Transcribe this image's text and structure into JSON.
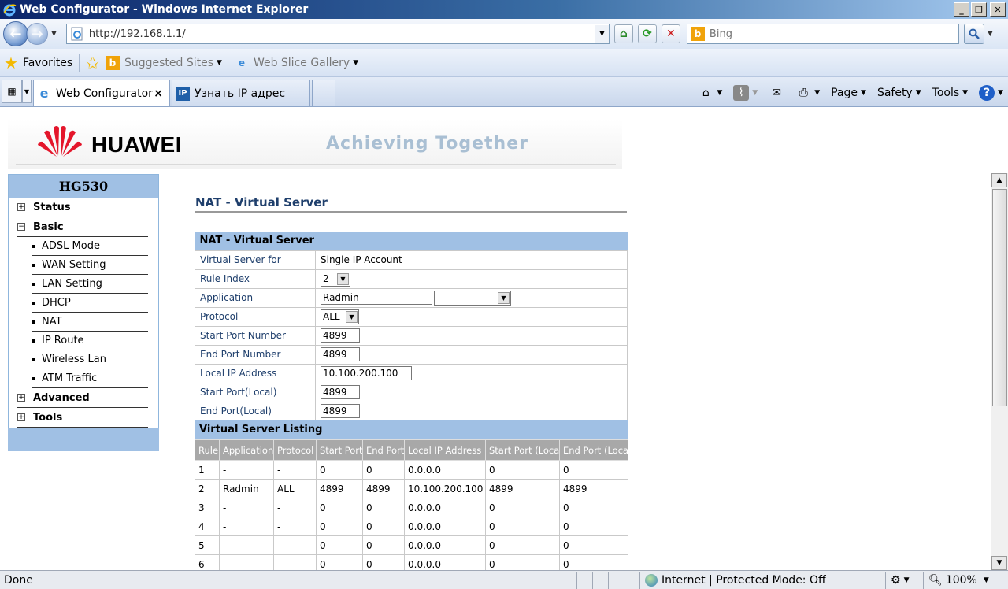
{
  "window": {
    "title": "Web Configurator - Windows Internet Explorer"
  },
  "address_bar": {
    "url": "http://192.168.1.1/",
    "search_placeholder": "Bing"
  },
  "favorites_bar": {
    "favorites_label": "Favorites",
    "items": [
      {
        "label": "Suggested Sites",
        "icon": "bing-icon"
      },
      {
        "label": "Web Slice Gallery",
        "icon": "ie-page-icon"
      }
    ]
  },
  "tabs": [
    {
      "label": "Web Configurator",
      "icon": "ie-page-icon",
      "active": true,
      "close": "×"
    },
    {
      "label": "Узнать IP адрес",
      "icon": "ip-icon",
      "icon_text": "IP",
      "active": false
    }
  ],
  "command_bar": {
    "page": "Page",
    "safety": "Safety",
    "tools": "Tools"
  },
  "banner": {
    "brand": "HUAWEI",
    "slogan": "Achieving Together"
  },
  "sidebar": {
    "model": "HG530",
    "items": [
      {
        "label": "Status",
        "expander": "+"
      },
      {
        "label": "Basic",
        "expander": "−"
      },
      {
        "label": "ADSL Mode"
      },
      {
        "label": "WAN Setting"
      },
      {
        "label": "LAN Setting"
      },
      {
        "label": "DHCP"
      },
      {
        "label": "NAT"
      },
      {
        "label": "IP Route"
      },
      {
        "label": "Wireless Lan"
      },
      {
        "label": "ATM Traffic"
      },
      {
        "label": "Advanced",
        "expander": "+"
      },
      {
        "label": "Tools",
        "expander": "+"
      }
    ]
  },
  "main": {
    "page_title": "NAT - Virtual Server",
    "form": {
      "section_title": "NAT - Virtual Server",
      "virtual_server_for": {
        "label": "Virtual Server for",
        "value": "Single IP Account"
      },
      "rule_index": {
        "label": "Rule Index",
        "value": "2"
      },
      "application": {
        "label": "Application",
        "value": "Radmin",
        "preset": "-"
      },
      "protocol": {
        "label": "Protocol",
        "value": "ALL"
      },
      "start_port": {
        "label": "Start Port Number",
        "value": "4899"
      },
      "end_port": {
        "label": "End Port Number",
        "value": "4899"
      },
      "local_ip": {
        "label": "Local IP Address",
        "value": "10.100.200.100"
      },
      "start_port_local": {
        "label": "Start Port(Local)",
        "value": "4899"
      },
      "end_port_local": {
        "label": "End Port(Local)",
        "value": "4899"
      }
    },
    "listing": {
      "title": "Virtual Server Listing",
      "headers": [
        "Rule",
        "Application",
        "Protocol",
        "Start Port",
        "End Port",
        "Local IP Address",
        "Start Port (Local)",
        "End Port (Local)"
      ],
      "rows": [
        [
          "1",
          "-",
          "-",
          "0",
          "0",
          "0.0.0.0",
          "0",
          "0"
        ],
        [
          "2",
          "Radmin",
          "ALL",
          "4899",
          "4899",
          "10.100.200.100",
          "4899",
          "4899"
        ],
        [
          "3",
          "-",
          "-",
          "0",
          "0",
          "0.0.0.0",
          "0",
          "0"
        ],
        [
          "4",
          "-",
          "-",
          "0",
          "0",
          "0.0.0.0",
          "0",
          "0"
        ],
        [
          "5",
          "-",
          "-",
          "0",
          "0",
          "0.0.0.0",
          "0",
          "0"
        ],
        [
          "6",
          "-",
          "-",
          "0",
          "0",
          "0.0.0.0",
          "0",
          "0"
        ]
      ]
    }
  },
  "status_bar": {
    "status": "Done",
    "zone": "Internet | Protected Mode: Off",
    "zoom": "100%"
  }
}
